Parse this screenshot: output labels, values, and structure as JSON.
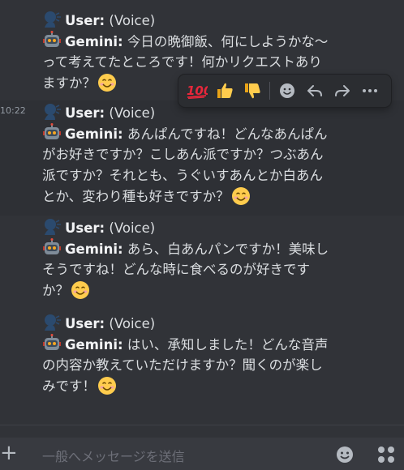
{
  "messages": [
    {
      "timestamp": "",
      "user_name": "User:",
      "user_suffix": "(Voice)",
      "bot_name": "Gemini:",
      "lines": [
        "今日の晩御飯、何にしようかな〜",
        "って考えてたところです！何かリクエストあり",
        "ますか？"
      ]
    },
    {
      "timestamp": "10:22",
      "user_name": "User:",
      "user_suffix": "(Voice)",
      "bot_name": "Gemini:",
      "lines": [
        "あんぱんですね！どんなあんぱん",
        "がお好きですか？こしあん派ですか？つぶあん",
        "派ですか？それとも、うぐいすあんとか白あん",
        "とか、変わり種も好きですか？"
      ]
    },
    {
      "timestamp": "",
      "user_name": "User:",
      "user_suffix": "(Voice)",
      "bot_name": "Gemini:",
      "lines": [
        "あら、白あんパンですか！美味し",
        "そうですね！どんな時に食べるのが好きです",
        "か？"
      ]
    },
    {
      "timestamp": "",
      "user_name": "User:",
      "user_suffix": "(Voice)",
      "bot_name": "Gemini:",
      "lines": [
        "はい、承知しました！どんな音声",
        "の内容か教えていただけますか？聞くのが楽し",
        "みです！"
      ]
    }
  ],
  "toolbar": {
    "reactions": [
      "hundred-points-icon",
      "thumbs-up-icon",
      "thumbs-down-icon"
    ],
    "actions": [
      "add-reaction-icon",
      "reply-icon",
      "forward-icon",
      "more-icon"
    ]
  },
  "composer": {
    "placeholder": "一般へメッセージを送信",
    "plus_label": "+"
  },
  "colors": {
    "background": "#313338",
    "highlight": "#2e3035",
    "toolbar_bg": "#2b2d31",
    "text": "#dbdee1",
    "muted": "#949ba4"
  }
}
